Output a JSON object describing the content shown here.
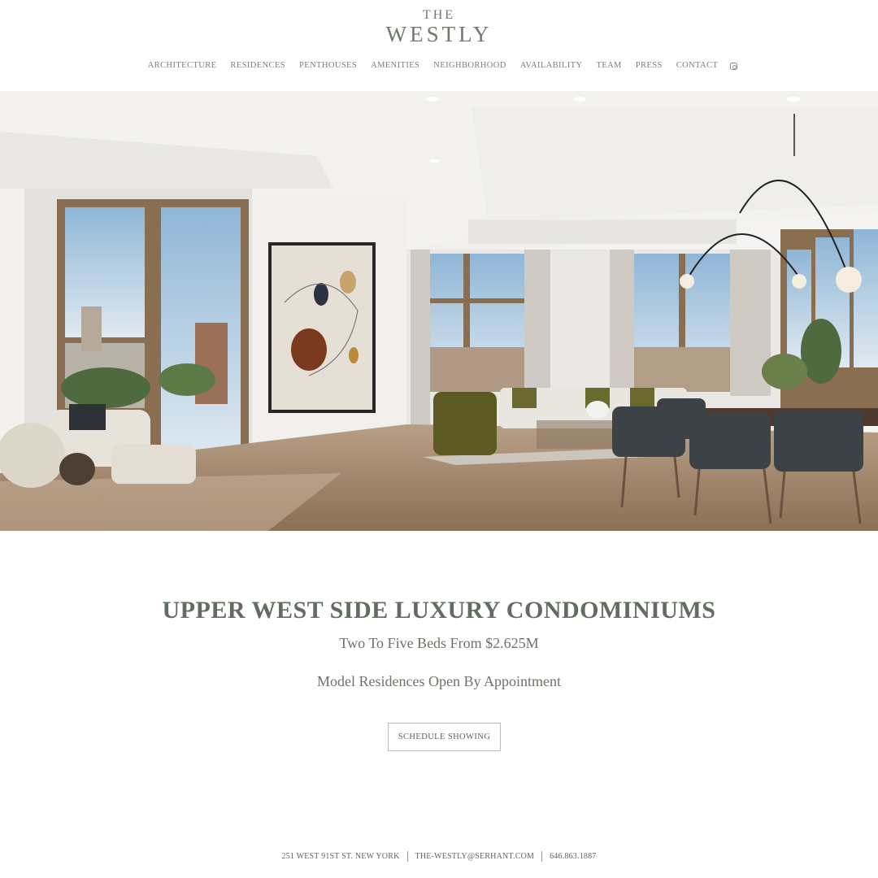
{
  "brand": {
    "the": "THE",
    "name": "WESTLY"
  },
  "nav": {
    "items": [
      "ARCHITECTURE",
      "RESIDENCES",
      "PENTHOUSES",
      "AMENITIES",
      "NEIGHBORHOOD",
      "AVAILABILITY",
      "TEAM",
      "PRESS",
      "CONTACT"
    ],
    "social_icon": "instagram-icon"
  },
  "hero": {
    "image": "interior-living-dining-room"
  },
  "main": {
    "headline": "UPPER WEST SIDE LUXURY CONDOMINIUMS",
    "subheadline": "Two To Five Beds From $2.625M",
    "tagline": "Model Residences Open By Appointment",
    "cta_label": "SCHEDULE SHOWING"
  },
  "footer": {
    "address": "251 WEST 91ST ST. NEW YORK",
    "email": "THE-WESTLY@SERHANT.COM",
    "phone": "646.863.1887"
  },
  "colors": {
    "text": "#626c60",
    "nav": "#7a7f78",
    "border": "#b9bdb7"
  }
}
